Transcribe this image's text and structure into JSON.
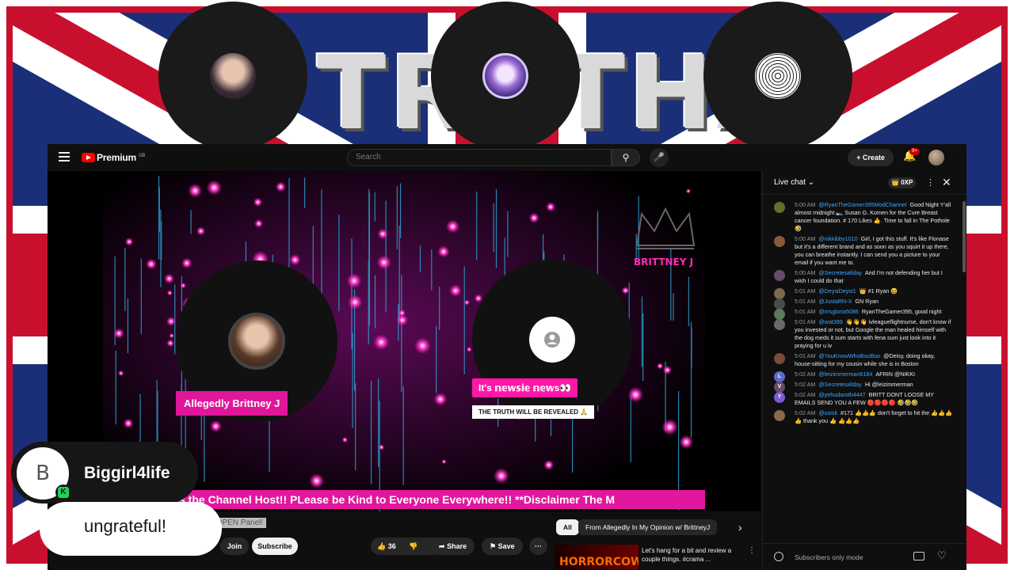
{
  "overlay": {
    "comment": {
      "author_initial": "B",
      "author": "Biggirl4life",
      "badge": "K",
      "message": "ungrateful!"
    },
    "bg_title": "TRUTHA"
  },
  "youtube": {
    "brand": "Premium",
    "brand_region": "GB",
    "search_placeholder": "Search",
    "create_label": "+ Create",
    "notif_count": "9+"
  },
  "video": {
    "watermark": "BRITTNEY J",
    "host_tag": "Allegedly Brittney J",
    "guest_tag": "It's 𝕟𝕖𝕨𝕤𝕚𝕖 𝕟𝕖𝕨s👀",
    "guest_sub_tag": "THE TRUTH WILL BE REVEALED 🙏",
    "ticker": "s the Channel Host!! PLease be Kind to Everyone Everywhere!! **Disclaimer The M"
  },
  "below": {
    "title_fragment": "ht!! OPEN Panel!",
    "join": "Join",
    "subscribe": "Subscribe",
    "likes": "36",
    "share": "Share",
    "save": "Save",
    "more": "···",
    "chips": [
      "All",
      "From Allegedly In My Opinion w/ BrittneyJ"
    ],
    "rec_thumb_text": "HORRORCOW",
    "rec_title": "Let's hang for a bit and review a couple things. #crama ..."
  },
  "chat": {
    "title": "Live chat",
    "xp": "0XP",
    "input_placeholder": "Subscribers only mode",
    "messages": [
      {
        "time": "5:00 AM",
        "author": "@RyanTheGamer395ModChannel",
        "text": "Good Night Y'all almost midnight 🛌 Susan G. Komen for the Cure Breast cancer foundation. # 170 Likes 👍. Time to fall in The Pothole 🤣",
        "color": "#6b6b2a"
      },
      {
        "time": "5:00 AM",
        "author": "@nikkibby1010",
        "text": "Girl, I got this stuff. It's like Flonase but it's a different brand and as soon as you squirt it up there, you can breathe instantly. I can send you a picture to your email if you want me to.",
        "color": "#8a5a3a"
      },
      {
        "time": "5:00 AM",
        "author": "@Secretesallday",
        "text": "And I'm not defending her but I wish I could do that",
        "color": "#6a4a6a"
      },
      {
        "time": "5:01 AM",
        "author": "@DeysiDeysi1",
        "text": "👑 #1 Ryan 😆",
        "color": "#7a6a4a"
      },
      {
        "time": "5:01 AM",
        "author": "@JustaRN-X",
        "text": "GN Ryan",
        "color": "#4a4a4a"
      },
      {
        "time": "5:01 AM",
        "author": "@msgloria5086",
        "text": "RyanTheGamer395, good night",
        "color": "#5a7a5a"
      },
      {
        "time": "5:01 AM",
        "author": "@wat399",
        "text": "👋👋👋 ivleagueflightnurse, don't know if you invested or not, but Google the man healed himself with the dog meds it sum starts with fena sum just look into it praying for u iv",
        "color": "#6a6a6a"
      },
      {
        "time": "5:01 AM",
        "author": "@YouKnowWhoBooBoo",
        "text": "@Deisy, doing okay, house-sitting for my cousin while she is in Boston",
        "color": "#7a4a3a"
      },
      {
        "time": "5:02 AM",
        "author": "@leizimmerman6184",
        "text": "AFRIN @NIKKI",
        "color": "#5b6bd0",
        "initial": "L"
      },
      {
        "time": "5:02 AM",
        "author": "@Secretesallday",
        "text": "Hi @leizimmerman",
        "color": "#6a4a6a",
        "initial": "V"
      },
      {
        "time": "5:02 AM",
        "author": "@yehudaroth4447",
        "text": "BRITT DONT LOOSE MY EMAILS SEND YOU A FEW 🔴🔴🔴🔴 🤣🤣🤣",
        "color": "#7a5ad0",
        "initial": "Y"
      },
      {
        "time": "5:02 AM",
        "author": "@osisk",
        "text": "#171 👍👍👍 don't forget to hit the 👍👍👍👍 thank you 👍 👍👍👍",
        "color": "#8a6a4a"
      }
    ]
  },
  "colors": {
    "accent_pink": "#e0169a",
    "yt_red": "#ff0000",
    "chat_author": "#3ea6ff"
  }
}
